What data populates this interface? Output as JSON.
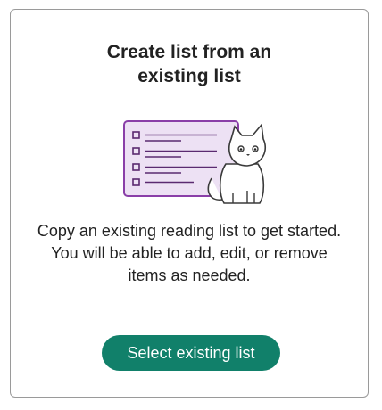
{
  "card": {
    "title_line1": "Create list from an",
    "title_line2": "existing list",
    "description": "Copy an existing reading list to get started. You will be able to add, edit, or remove items as needed.",
    "button_label": "Select existing list",
    "illustration_icon": "reading-list-with-cat-icon"
  },
  "colors": {
    "accent": "#11806a",
    "illustration_purple": "#8a3fa8",
    "illustration_fill": "#ede1f4"
  }
}
